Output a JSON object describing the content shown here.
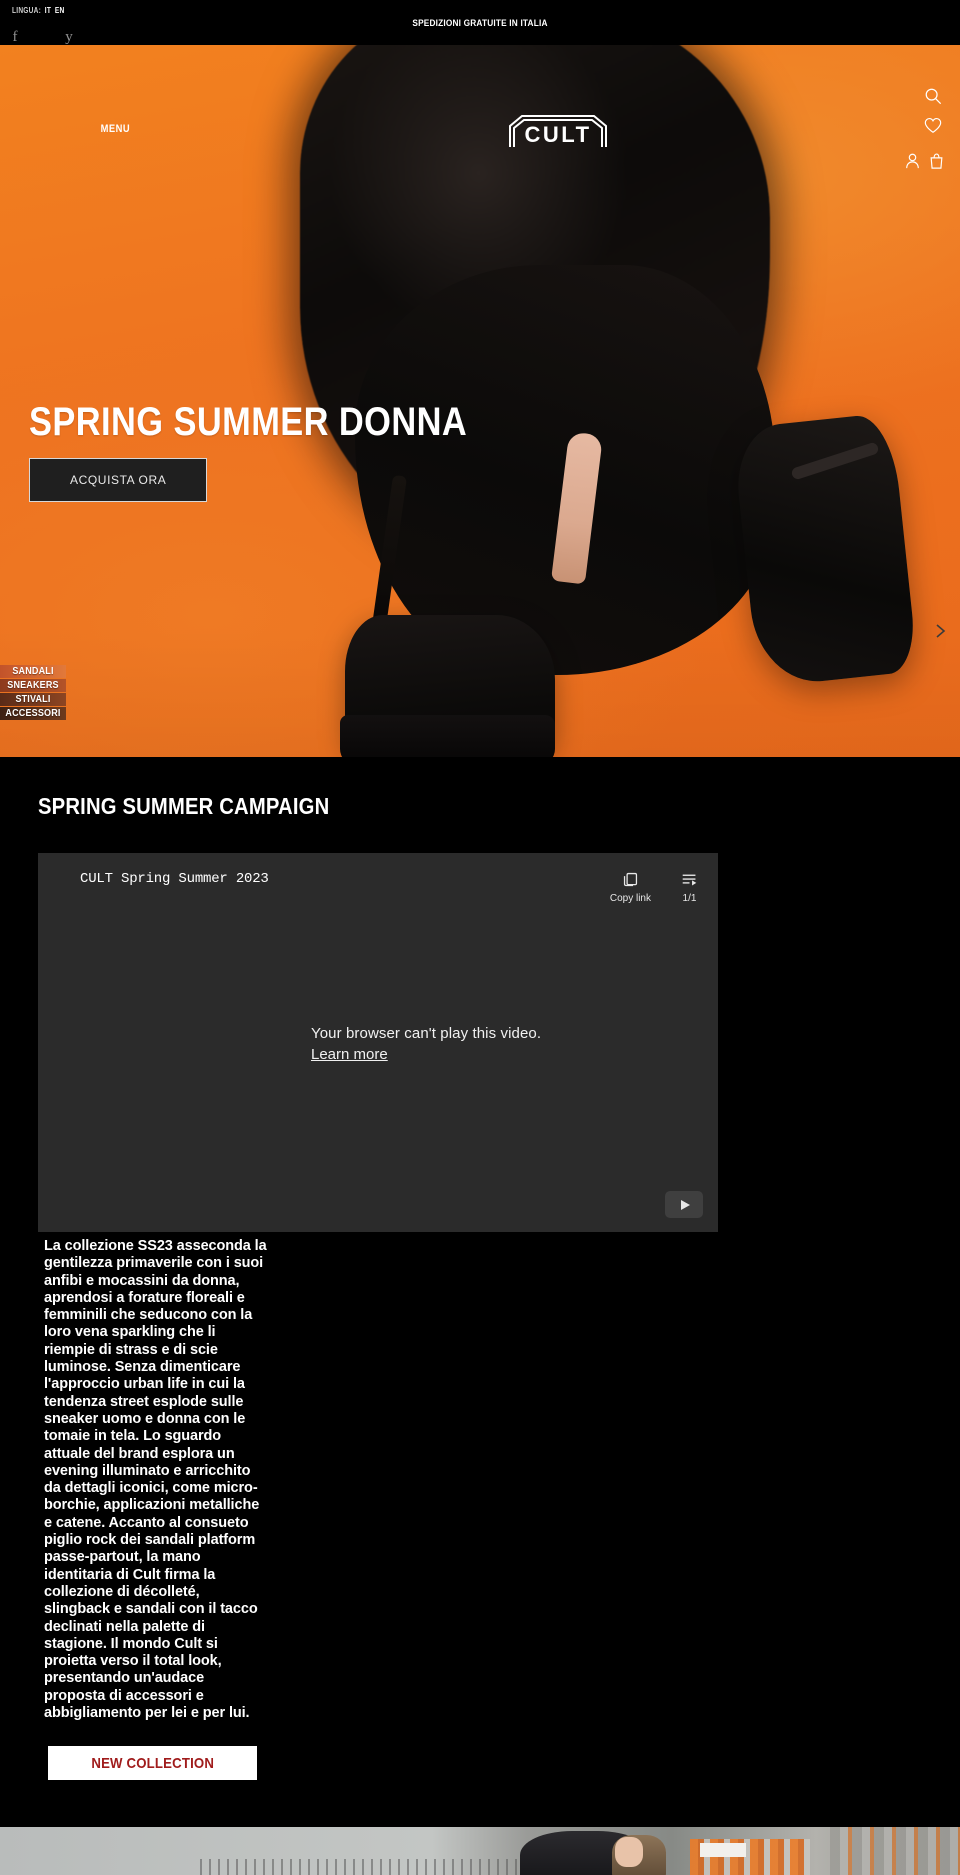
{
  "topbar": {
    "lang_label": "LINGUA:",
    "lang_it": "IT",
    "lang_en": "EN",
    "shipping_banner": "SPEDIZIONI GRATUITE IN ITALIA",
    "social": [
      {
        "name": "facebook-icon",
        "glyph": "f"
      },
      {
        "name": "twitter-icon",
        "glyph": "y"
      }
    ]
  },
  "header": {
    "menu_label": "MENU",
    "logo_text": "CULT",
    "icons": {
      "search": "search-icon",
      "wishlist": "heart-icon",
      "account": "user-icon",
      "cart": "bag-icon"
    }
  },
  "hero": {
    "title": "SPRING SUMMER DONNA",
    "cta_label": "ACQUISTA ORA",
    "thumbs": [
      {
        "label": "SANDALI"
      },
      {
        "label": "SNEAKERS"
      },
      {
        "label": "STIVALI"
      },
      {
        "label": "ACCESSORI"
      }
    ],
    "next_arrow": "chevron-right-icon"
  },
  "campaign": {
    "section_title": "SPRING SUMMER CAMPAIGN",
    "video": {
      "title": "CULT Spring Summer 2023",
      "copy_link_label": "Copy link",
      "playlist_counter": "1/1",
      "error_line1": "Your browser can't play this video.",
      "error_link": "Learn more"
    },
    "description": "La collezione SS23 asseconda la gentilezza primaverile con i suoi anfibi e mocassini da donna, aprendosi a forature floreali e femminili che seducono con la loro vena sparkling che li riempie di strass e di scie luminose. Senza dimenticare l'approccio urban life in cui la tendenza street esplode sulle sneaker uomo e donna con le tomaie in tela. Lo sguardo attuale del brand esplora un evening illuminato e arricchito da dettagli iconici, come micro-borchie, applicazioni metalliche e catene. Accanto al consueto piglio rock dei sandali platform passe-partout, la mano identitaria di Cult firma la collezione di décolleté, slingback e sandali con il tacco declinati nella palette di stagione. Il mondo Cult si proietta verso il total look, presentando un'audace proposta di accessori e abbigliamento per lei e per lui.",
    "cta_label": "NEW COLLECTION"
  },
  "colors": {
    "brand_orange": "#ef7621",
    "background_black": "#000000",
    "accent_red": "#a01c1c",
    "video_bg": "#2b2b2b"
  }
}
